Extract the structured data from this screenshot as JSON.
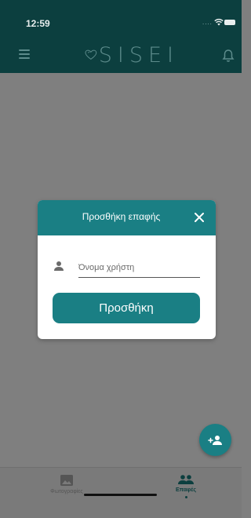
{
  "status_bar": {
    "time": "12:59",
    "signal": "....",
    "wifi_icon": "wifi-icon",
    "battery_icon": "battery-icon"
  },
  "app_bar": {
    "menu_icon": "hamburger-menu-icon",
    "logo_text": "SISEI",
    "notification_icon": "bell-icon",
    "background_color": "#0c3f3f",
    "logo_color": "#5d8c8c"
  },
  "dialog": {
    "title": "Προσθήκη επαφής",
    "close_icon": "close-icon",
    "field": {
      "icon": "user-icon",
      "placeholder": "Όνομα χρήστη",
      "value": ""
    },
    "button_label": "Προσθήκη",
    "accent_color": "#1a7f84"
  },
  "fab": {
    "icon": "add-person-icon"
  },
  "bottom_nav": {
    "items": [
      {
        "label": "Φωτογραφίες",
        "icon": "image-icon",
        "active": false
      },
      {
        "label": "Επαφές",
        "icon": "people-icon",
        "active": true
      }
    ]
  }
}
